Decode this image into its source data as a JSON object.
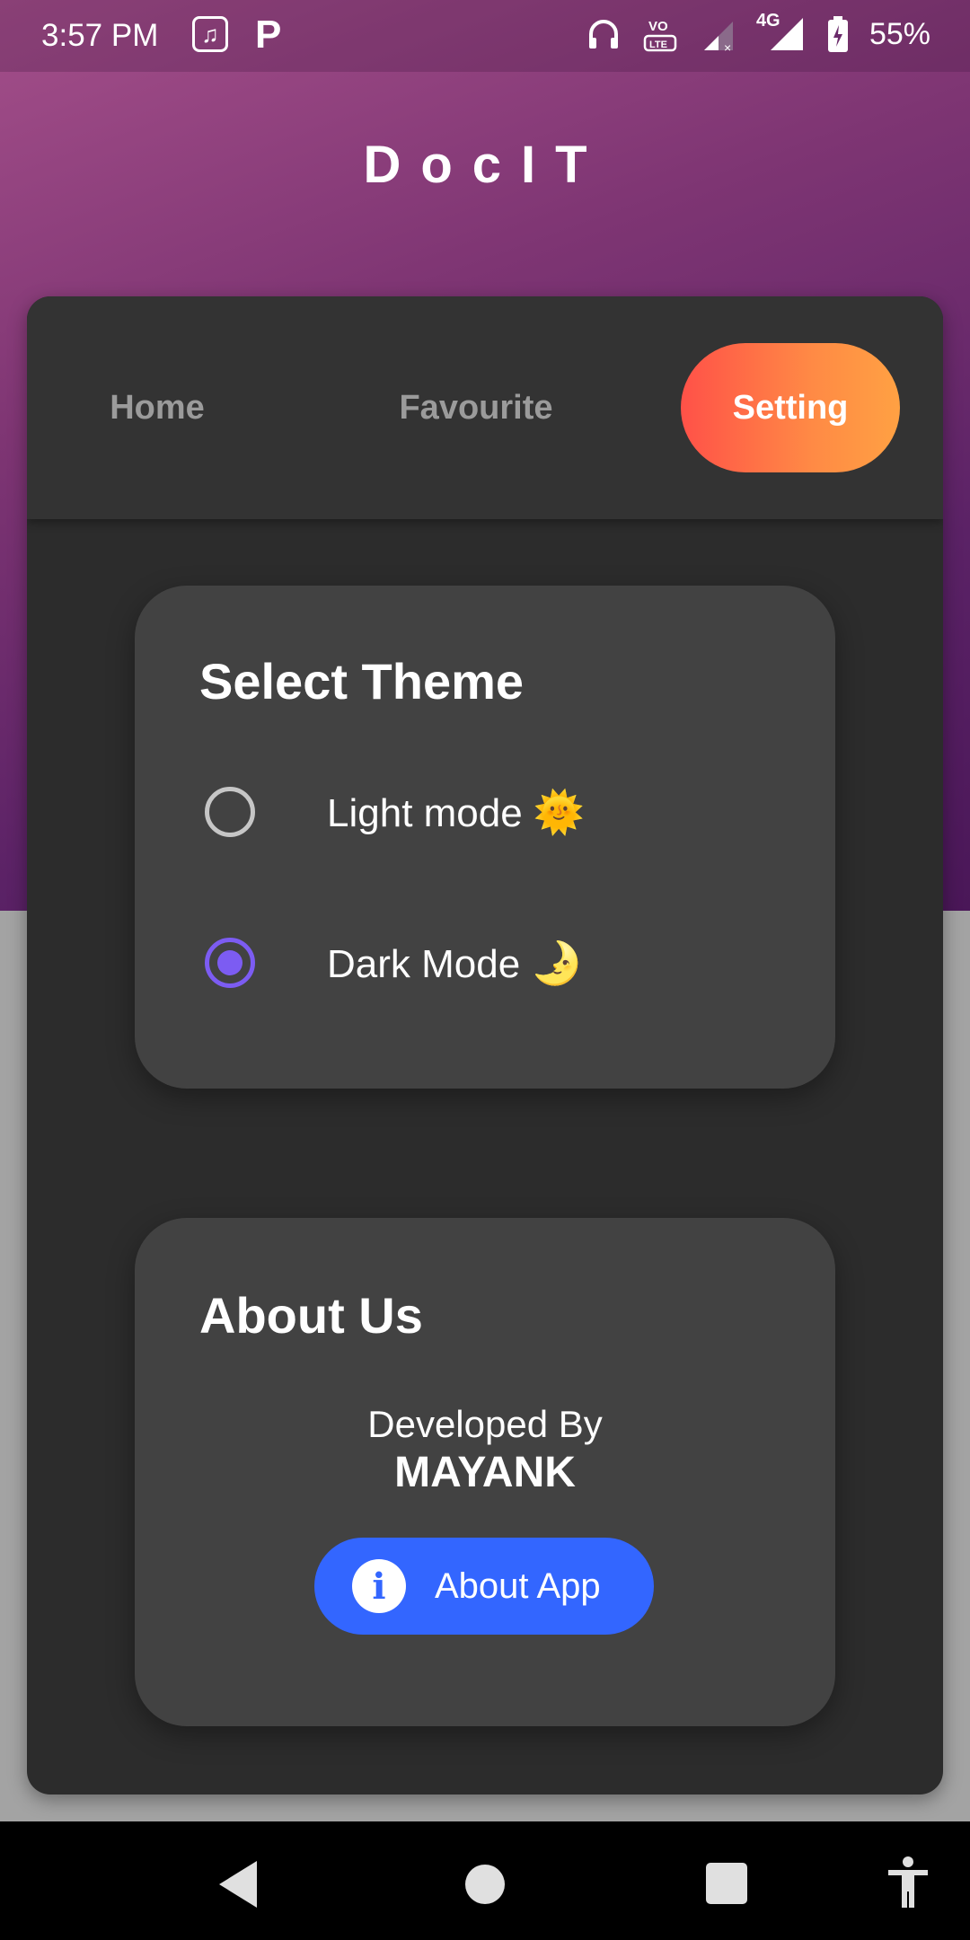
{
  "status_bar": {
    "time": "3:57 PM",
    "network": "4G",
    "battery": "55%",
    "icons": [
      "saavn-app-icon",
      "paytm-app-icon",
      "headphones-icon",
      "volte-icon",
      "signal-icon",
      "battery-icon"
    ]
  },
  "app": {
    "title": "DocIT"
  },
  "tabs": {
    "home": "Home",
    "favourite": "Favourite",
    "setting": "Setting",
    "active": "Setting"
  },
  "theme": {
    "title": "Select Theme",
    "options": [
      {
        "label": "Light mode",
        "emoji": "🌞",
        "selected": false
      },
      {
        "label": "Dark Mode",
        "emoji": "🌛",
        "selected": true
      }
    ]
  },
  "about": {
    "title": "About Us",
    "developed_by": "Developed By",
    "developer": "MAYANK",
    "button_label": "About App",
    "button_icon": "info-icon"
  },
  "colors": {
    "accent_tab_start": "#ff5148",
    "accent_tab_end": "#ffa143",
    "radio_selected": "#7c5cf2",
    "about_button": "#3366ff",
    "card_bg": "#2c2c2c",
    "panel_bg": "#424242"
  }
}
